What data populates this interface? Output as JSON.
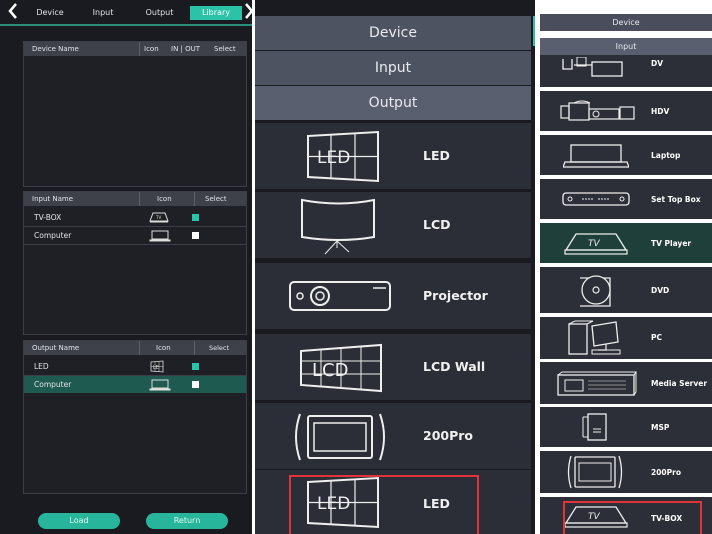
{
  "left_panel": {
    "tabs": [
      "Device",
      "Input",
      "Output",
      "Library"
    ],
    "active_tab": "Library",
    "device_table": {
      "headers": {
        "name": "Device Name",
        "icon": "Icon",
        "inout": "IN | OUT",
        "select": "Select"
      }
    },
    "input_table": {
      "headers": {
        "name": "Input Name",
        "icon": "Icon",
        "select": "Select"
      },
      "rows": [
        {
          "name": "TV-BOX",
          "icon": "tv-box-icon",
          "checked": true
        },
        {
          "name": "Computer",
          "icon": "laptop-icon",
          "checked": false
        }
      ]
    },
    "output_table": {
      "headers": {
        "name": "Output Name",
        "icon": "Icon",
        "select": "Select"
      },
      "rows": [
        {
          "name": "LED",
          "icon": "led-wall-icon",
          "checked": true
        },
        {
          "name": "Computer",
          "icon": "laptop-icon",
          "checked": false,
          "highlighted": true
        }
      ]
    },
    "buttons": {
      "load": "Load",
      "return": "Return"
    },
    "colors": {
      "accent": "#2bc3a7",
      "highlight_row": "#1f5a50"
    }
  },
  "middle_panel": {
    "tabs": [
      "Device",
      "Input",
      "Output"
    ],
    "items": [
      {
        "label": "LED",
        "icon": "led-wall-icon"
      },
      {
        "label": "LCD",
        "icon": "lcd-screen-icon"
      },
      {
        "label": "Projector",
        "icon": "projector-icon"
      },
      {
        "label": "LCD Wall",
        "icon": "lcd-wall-icon"
      },
      {
        "label": "200Pro",
        "icon": "200pro-icon"
      },
      {
        "label": "LED",
        "icon": "led-wall-icon",
        "selected": true
      }
    ]
  },
  "right_panel": {
    "tabs": [
      "Device",
      "Input"
    ],
    "items": [
      {
        "label": "DV",
        "icon": "dv-camera-icon"
      },
      {
        "label": "HDV",
        "icon": "hdv-camera-icon"
      },
      {
        "label": "Laptop",
        "icon": "laptop-icon"
      },
      {
        "label": "Set Top Box",
        "icon": "set-top-box-icon"
      },
      {
        "label": "TV Player",
        "icon": "tv-player-icon",
        "highlighted": true
      },
      {
        "label": "DVD",
        "icon": "dvd-icon"
      },
      {
        "label": "PC",
        "icon": "pc-icon"
      },
      {
        "label": "Media Server",
        "icon": "media-server-icon"
      },
      {
        "label": "MSP",
        "icon": "msp-icon"
      },
      {
        "label": "200Pro",
        "icon": "200pro-icon"
      },
      {
        "label": "TV-BOX",
        "icon": "tv-box-icon",
        "selected": true
      }
    ]
  }
}
